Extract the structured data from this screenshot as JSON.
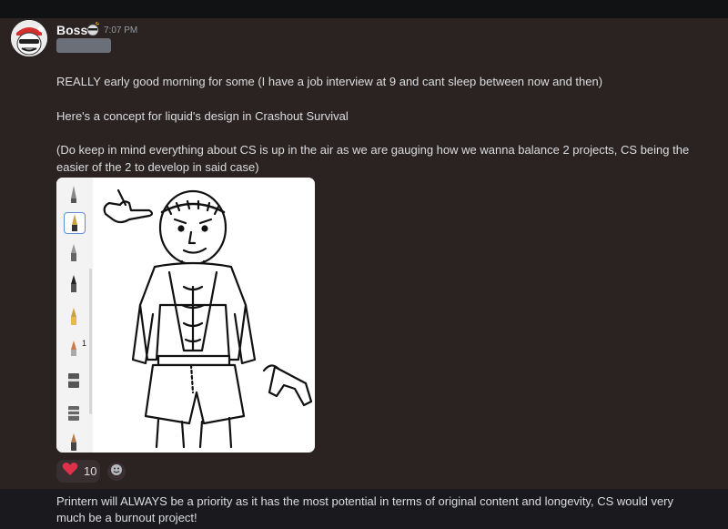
{
  "message": {
    "username": "Boss",
    "timestamp": "7:07 PM",
    "lines": [
      "REALLY early good morning for some (I have a job interview at 9 and cant sleep between now and then)",
      "Here's a concept for liquid's design in Crashout Survival",
      "(Do keep in mind everything about CS is up in the air as we are gauging how we wanna balance 2 projects, CS being the",
      "easier of the 2 to develop in said case)"
    ],
    "reaction": {
      "icon": "heart-icon",
      "count": "10"
    },
    "add_reaction_icon": "smiley-icon"
  },
  "image": {
    "toolbar_superscript": "1",
    "tool_icons": [
      "pen-icon",
      "fountain-pen-icon",
      "marker-icon",
      "ink-pen-icon",
      "pencil-icon",
      "crayon-icon",
      "eraser-icon",
      "stamp-icon",
      "pencil-icon"
    ]
  },
  "next_message": {
    "lines": [
      "Printern will ALWAYS be a priority as it has the most potential in terms of original content and longevity, CS would very",
      "much be a burnout project!"
    ]
  },
  "colors": {
    "background": "#1a1a1e",
    "message_bg": "#2b2222",
    "text": "#dbdee1",
    "heart": "#e0314b"
  }
}
